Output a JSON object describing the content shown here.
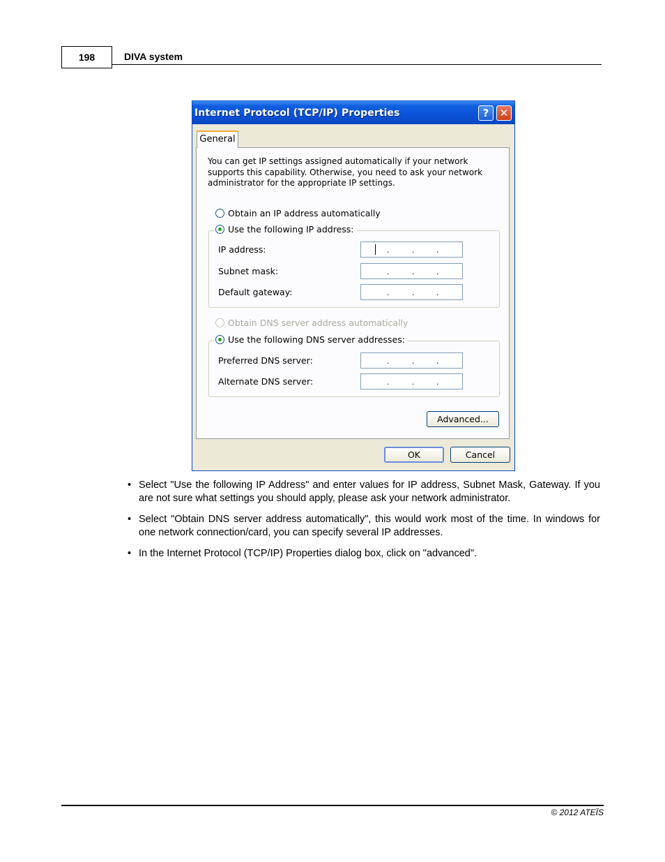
{
  "header": {
    "page_number": "198",
    "doc_title": "DIVA system"
  },
  "dialog": {
    "title": "Internet Protocol (TCP/IP) Properties",
    "help_label": "?",
    "close_label": "✕",
    "tab_label": "General",
    "intro_text": "You can get IP settings assigned automatically if your network supports this capability. Otherwise, you need to ask your network administrator for the appropriate IP settings.",
    "radio_obtain_ip": "Obtain an IP address automatically",
    "radio_use_ip": "Use the following IP address:",
    "ip_fields": [
      {
        "label": "IP address:"
      },
      {
        "label": "Subnet mask:"
      },
      {
        "label": "Default gateway:"
      }
    ],
    "radio_obtain_dns": "Obtain DNS server address automatically",
    "radio_use_dns": "Use the following DNS server addresses:",
    "dns_fields": [
      {
        "label": "Preferred DNS server:"
      },
      {
        "label": "Alternate DNS server:"
      }
    ],
    "ip_separator": ".",
    "advanced_label": "Advanced...",
    "ok_label": "OK",
    "cancel_label": "Cancel"
  },
  "bullets": [
    "Select \"Use the following IP Address\" and enter values for IP address, Subnet Mask, Gateway. If you are not sure what settings you should apply, please ask your network administrator.",
    "Select \"Obtain DNS server address automatically\", this would work most of the time. In windows for one network connection/card, you can specify several IP addresses.",
    "In the Internet Protocol (TCP/IP) Properties dialog box, click on \"advanced\"."
  ],
  "footer": {
    "copyright": "© 2012 ATEÏS"
  }
}
